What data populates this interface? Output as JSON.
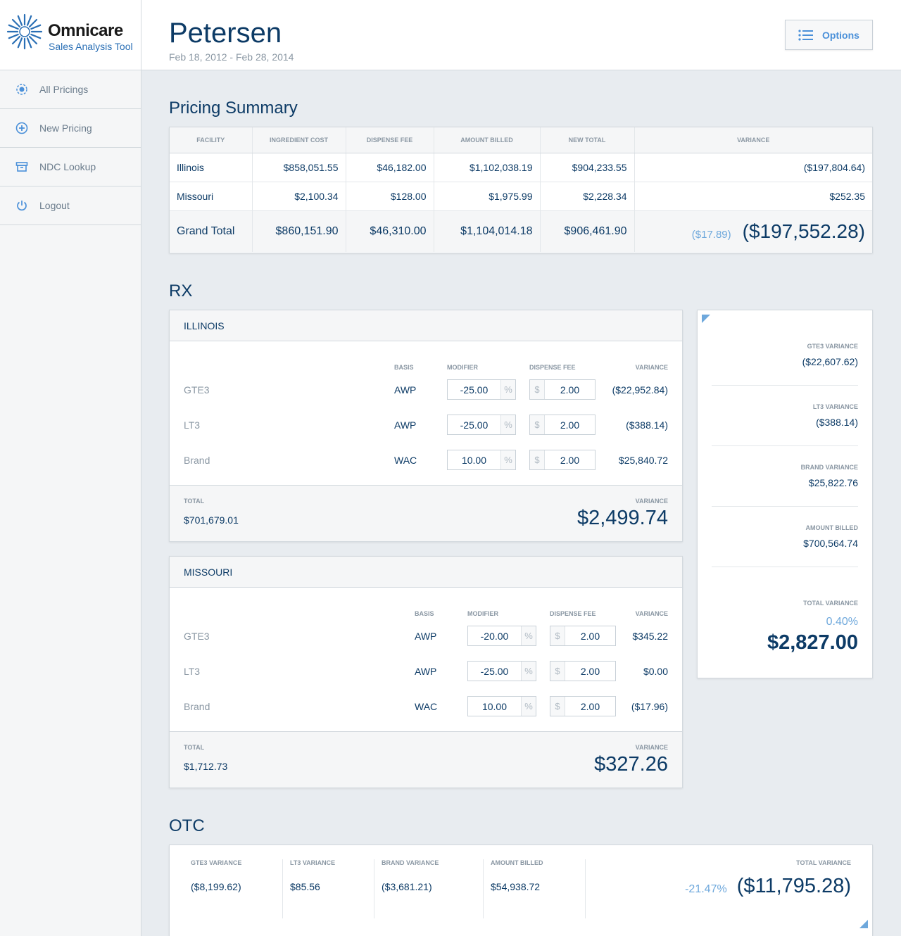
{
  "brand": {
    "name": "Omnicare",
    "subtitle": "Sales Analysis Tool"
  },
  "nav": [
    {
      "label": "All Pricings",
      "icon": "target-icon"
    },
    {
      "label": "New Pricing",
      "icon": "plus-circle-icon"
    },
    {
      "label": "NDC Lookup",
      "icon": "archive-box-icon"
    },
    {
      "label": "Logout",
      "icon": "power-icon"
    }
  ],
  "header": {
    "title": "Petersen",
    "date_range": "Feb 18, 2012 - Feb 28, 2014",
    "options_label": "Options"
  },
  "summary": {
    "title": "Pricing Summary",
    "columns": [
      "Facility",
      "Ingredient Cost",
      "Dispense Fee",
      "Amount Billed",
      "New Total",
      "Variance"
    ],
    "rows": [
      [
        "Illinois",
        "$858,051.55",
        "$46,182.00",
        "$1,102,038.19",
        "$904,233.55",
        "($197,804.64)"
      ],
      [
        "Missouri",
        "$2,100.34",
        "$128.00",
        "$1,975.99",
        "$2,228.34",
        "$252.35"
      ]
    ],
    "grand": {
      "label": "Grand Total",
      "ingredient_cost": "$860,151.90",
      "dispense_fee": "$46,310.00",
      "amount_billed": "$1,104,014.18",
      "new_total": "$906,461.90",
      "variance_pct": "($17.89)",
      "variance": "($197,552.28)"
    }
  },
  "rx": {
    "title": "RX",
    "col_headers": {
      "basis": "Basis",
      "modifier": "Modifier",
      "dispense_fee": "Dispense Fee",
      "variance": "Variance"
    },
    "facilities": [
      {
        "name": "ILLINOIS",
        "rows": [
          {
            "label": "GTE3",
            "basis": "AWP",
            "modifier": "-25.00",
            "fee": "2.00",
            "variance": "($22,952.84)"
          },
          {
            "label": "LT3",
            "basis": "AWP",
            "modifier": "-25.00",
            "fee": "2.00",
            "variance": "($388.14)"
          },
          {
            "label": "Brand",
            "basis": "WAC",
            "modifier": "10.00",
            "fee": "2.00",
            "variance": "$25,840.72"
          }
        ],
        "total_label": "TOTAL",
        "total": "$701,679.01",
        "variance_label": "VARIANCE",
        "variance": "$2,499.74"
      },
      {
        "name": "MISSOURI",
        "rows": [
          {
            "label": "GTE3",
            "basis": "AWP",
            "modifier": "-20.00",
            "fee": "2.00",
            "variance": "$345.22"
          },
          {
            "label": "LT3",
            "basis": "AWP",
            "modifier": "-25.00",
            "fee": "2.00",
            "variance": "$0.00"
          },
          {
            "label": "Brand",
            "basis": "WAC",
            "modifier": "10.00",
            "fee": "2.00",
            "variance": "($17.96)"
          }
        ],
        "total_label": "TOTAL",
        "total": "$1,712.73",
        "variance_label": "VARIANCE",
        "variance": "$327.26"
      }
    ],
    "percent_symbol": "%",
    "dollar_symbol": "$",
    "stats": [
      {
        "label": "GTE3 VARIANCE",
        "value": "($22,607.62)"
      },
      {
        "label": "LT3 VARIANCE",
        "value": "($388.14)"
      },
      {
        "label": "BRAND VARIANCE",
        "value": "$25,822.76"
      },
      {
        "label": "AMOUNT BILLED",
        "value": "$700,564.74"
      }
    ],
    "total_variance": {
      "label": "TOTAL VARIANCE",
      "pct": "0.40%",
      "value": "$2,827.00"
    }
  },
  "otc": {
    "title": "OTC",
    "stats": [
      {
        "label": "GTE3 VARIANCE",
        "value": "($8,199.62)"
      },
      {
        "label": "LT3 VARIANCE",
        "value": "$85.56"
      },
      {
        "label": "BRAND VARIANCE",
        "value": "($3,681.21)"
      },
      {
        "label": "AMOUNT BILLED",
        "value": "$54,938.72"
      }
    ],
    "total_variance": {
      "label": "TOTAL VARIANCE",
      "pct": "-21.47%",
      "value": "($11,795.28)"
    }
  },
  "colors": {
    "navy": "#0d3b66",
    "accent": "#4a90d9",
    "muted": "#8a97a3",
    "light_blue": "#6ea8dc"
  }
}
